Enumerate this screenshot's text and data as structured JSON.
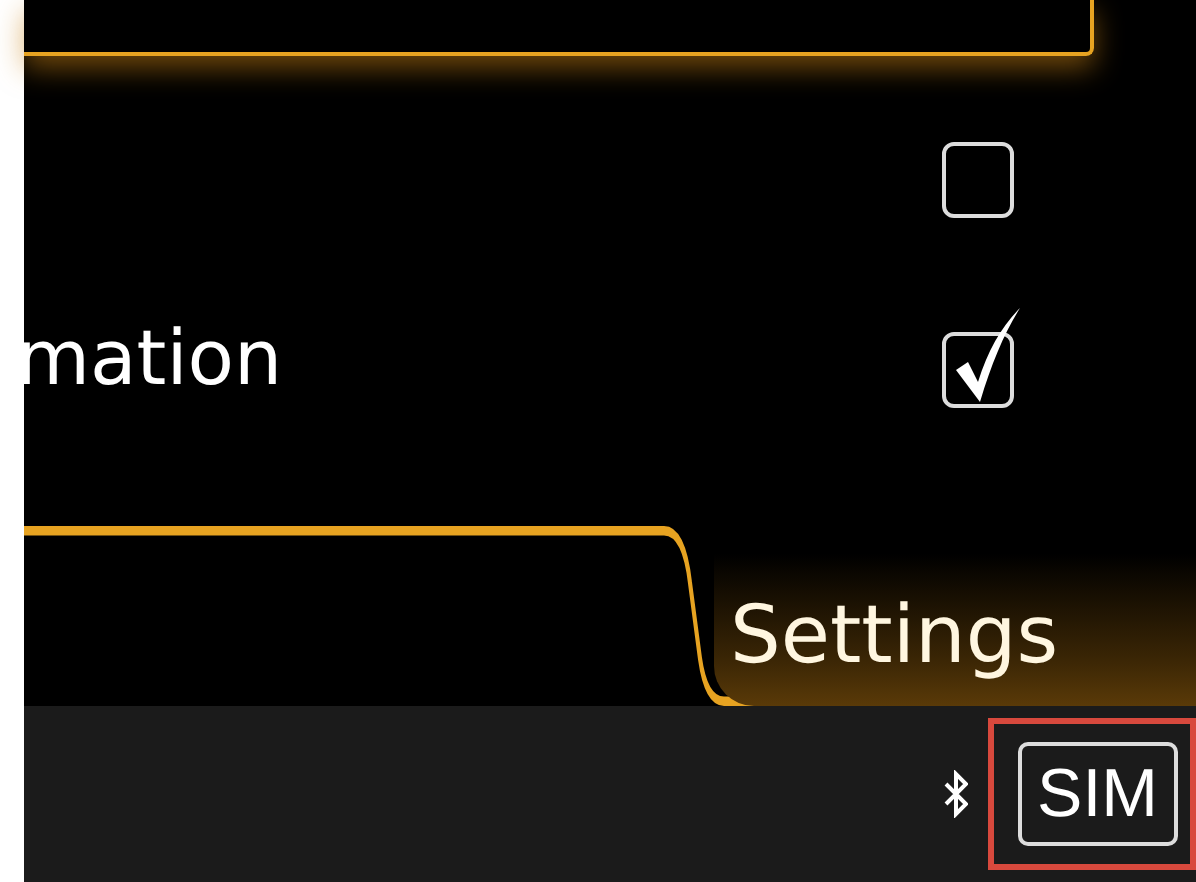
{
  "options": [
    {
      "checked": false
    },
    {
      "label": "mation",
      "checked": true
    }
  ],
  "tabs": [
    {
      "label": "Settings",
      "selected": true
    }
  ],
  "status_bar": {
    "sim": "SIM"
  }
}
